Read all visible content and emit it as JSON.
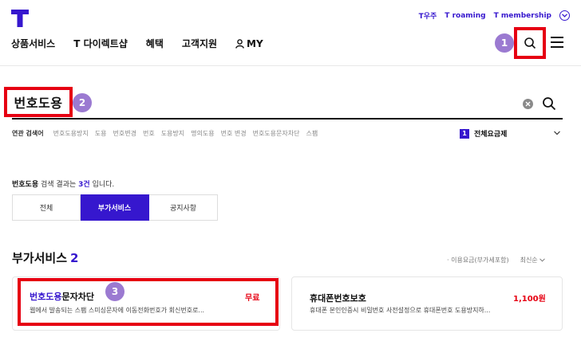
{
  "header": {
    "logo_text": "T",
    "top_links": [
      "T우주",
      "T roaming",
      "T membership"
    ],
    "nav": [
      "상품서비스",
      "T 다이렉트샵",
      "혜택",
      "고객지원",
      "MY"
    ]
  },
  "markers": [
    "1",
    "2",
    "3"
  ],
  "search": {
    "query": "번호도용"
  },
  "related": {
    "label": "연관 검색어",
    "items": [
      "번호도용방지",
      "도용",
      "번호변경",
      "번호",
      "도용방지",
      "명의도용",
      "번호 변경",
      "번호도용문자차단",
      "스팸"
    ]
  },
  "popular_plan": {
    "rank": "1",
    "name": "전체요금제"
  },
  "summary": {
    "keyword": "번호도용",
    "text1": "검색 결과는",
    "count": "3건",
    "text2": "입니다."
  },
  "tabs": [
    {
      "label": "전체",
      "active": false
    },
    {
      "label": "부가서비스",
      "active": true
    },
    {
      "label": "공지사항",
      "active": false
    }
  ],
  "section": {
    "title": "부가서비스",
    "count": "2",
    "fee_label": "이용요금(부가세포함)",
    "sort_label": "최신순"
  },
  "cards": [
    {
      "title_highlight": "번호도용",
      "title_rest": "문자차단",
      "price": "무료",
      "desc": "웹에서 발송되는 스팸 스미싱문자에 이동전화번호가 회신번호로..."
    },
    {
      "title": "휴대폰번호보호",
      "price": "1,100원",
      "desc": "휴대폰 본인인증시 비밀번호 사전설정으로 휴대폰번호 도용방지하..."
    }
  ],
  "colors": {
    "brand": "#3617ce",
    "highlight_red": "#e60012",
    "marker_purple": "#9b7ad1"
  },
  "icons": [
    "t-logo-icon",
    "chevron-down-icon",
    "user-icon",
    "search-icon",
    "menu-icon",
    "clear-icon"
  ]
}
